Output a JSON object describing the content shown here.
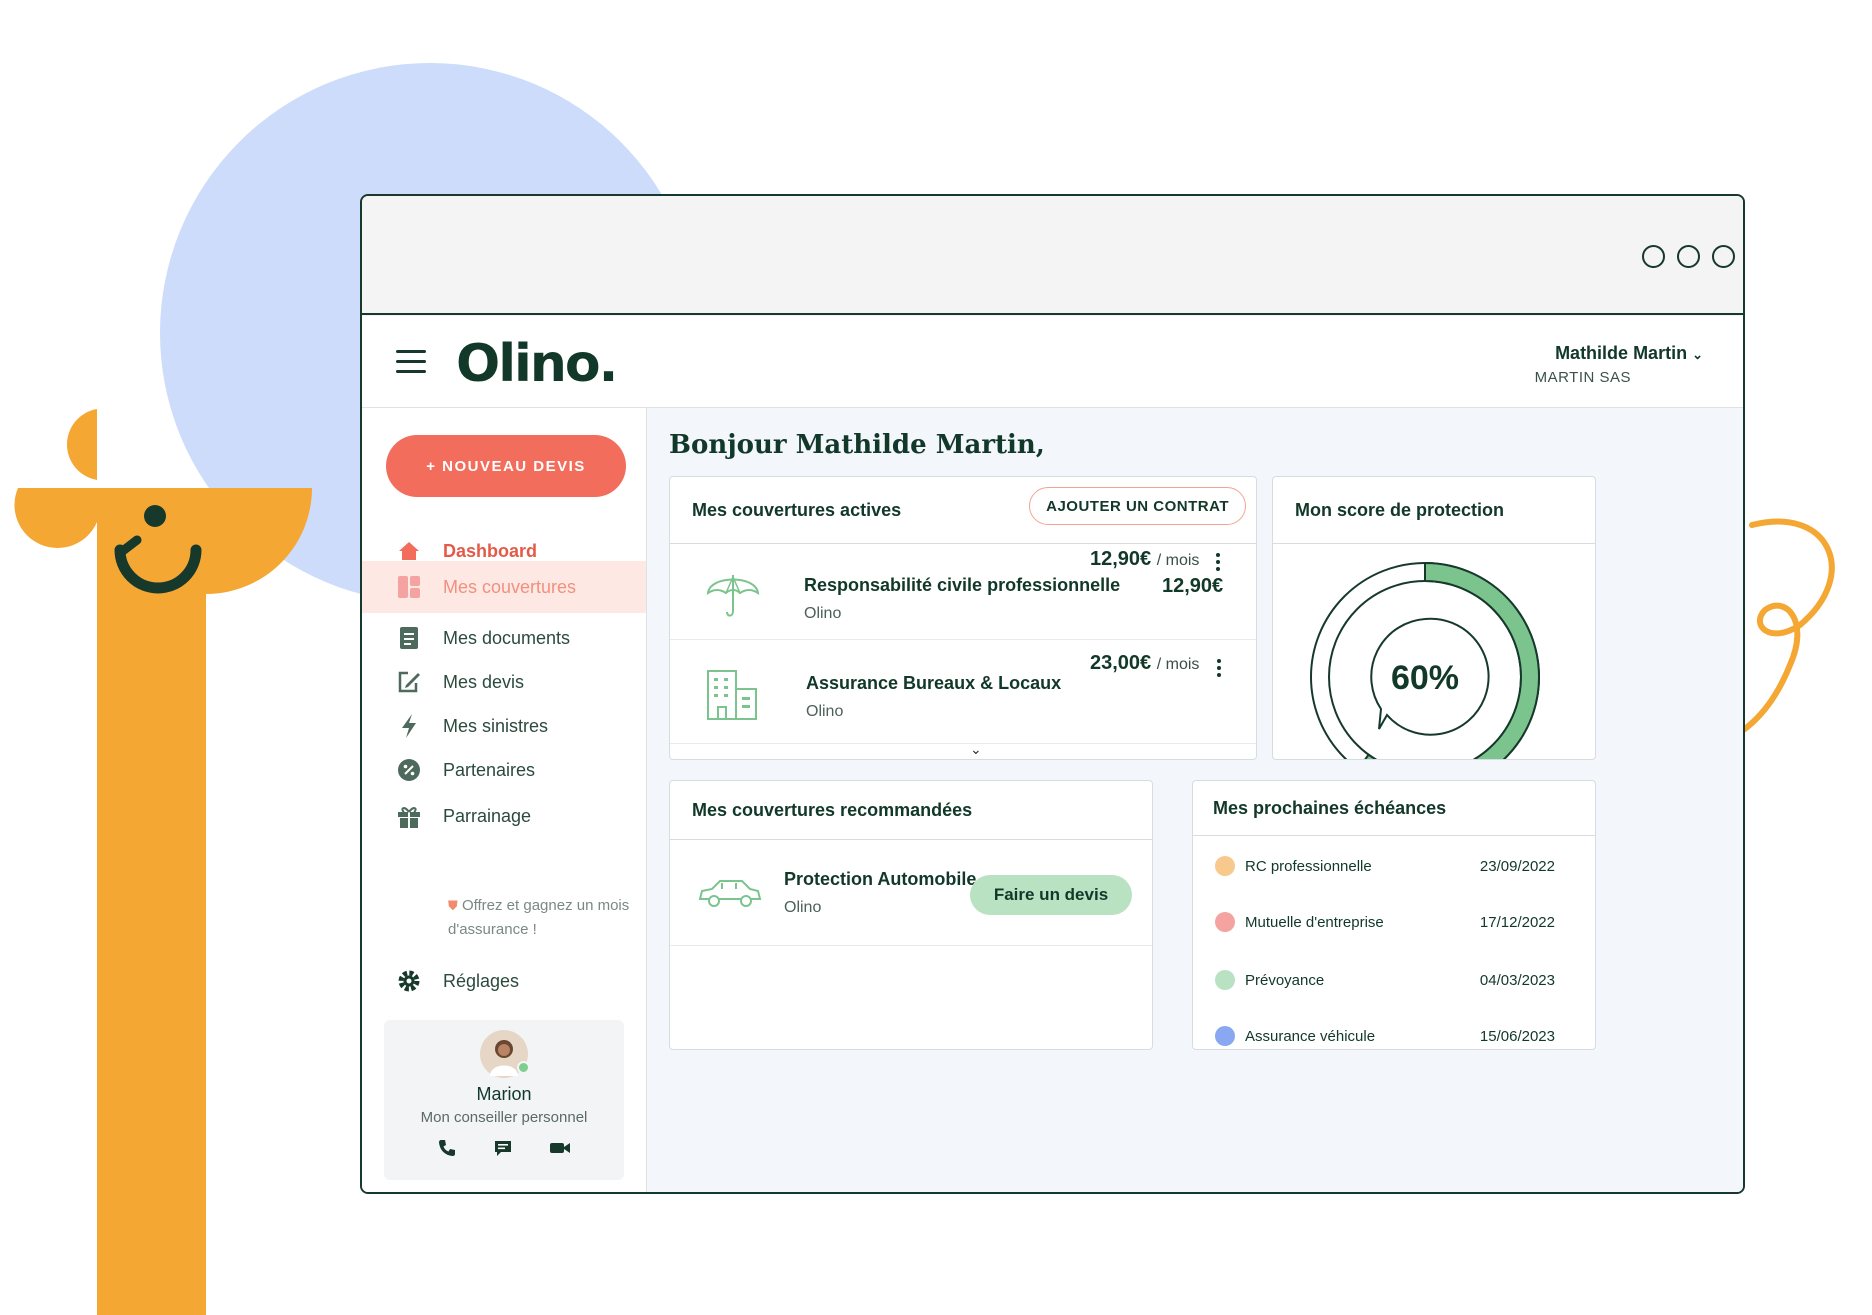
{
  "header": {
    "logo": "Olino.",
    "user_name": "Mathilde Martin",
    "user_company": "MARTIN SAS"
  },
  "sidebar": {
    "new_quote_label": "+ NOUVEAU DEVIS",
    "items": [
      {
        "label": "Dashboard",
        "icon": "home-icon"
      },
      {
        "label": "Mes couvertures",
        "icon": "grid-icon"
      },
      {
        "label": "Mes documents",
        "icon": "document-icon"
      },
      {
        "label": "Mes devis",
        "icon": "edit-icon"
      },
      {
        "label": "Mes sinistres",
        "icon": "lightning-icon"
      },
      {
        "label": "Partenaires",
        "icon": "percent-badge-icon"
      },
      {
        "label": "Parrainage",
        "icon": "gift-icon"
      },
      {
        "label": "Réglages",
        "icon": "gear-icon"
      }
    ],
    "sponsor_sub": "Offrez et gagnez un mois d'assurance !",
    "advisor": {
      "name": "Marion",
      "role": "Mon conseiller personnel"
    }
  },
  "main": {
    "greeting": "Bonjour Mathilde Martin,",
    "active": {
      "title": "Mes couvertures actives",
      "add_label": "AJOUTER UN CONTRAT",
      "rows": [
        {
          "title": "Responsabilité civile professionnelle",
          "provider": "Olino",
          "price": "12,90€",
          "period": "/ mois"
        },
        {
          "title": "Assurance Bureaux & Locaux",
          "provider": "Olino",
          "price": "23,00€",
          "period": "/ mois"
        }
      ]
    },
    "score": {
      "title": "Mon score de protection",
      "value_label": "60%",
      "value": 0.6
    },
    "recommended": {
      "title": "Mes couvertures recommandées",
      "rows": [
        {
          "title": "Protection Automobile",
          "provider": "Olino",
          "cta": "Faire un devis"
        }
      ]
    },
    "due": {
      "title": "Mes prochaines échéances",
      "items": [
        {
          "label": "RC professionnelle",
          "date": "23/09/2022",
          "color": "#f7c98c"
        },
        {
          "label": "Mutuelle d'entreprise",
          "date": "17/12/2022",
          "color": "#f4a3a0"
        },
        {
          "label": "Prévoyance",
          "date": "04/03/2023",
          "color": "#b9e2c3"
        },
        {
          "label": "Assurance véhicule",
          "date": "15/06/2023",
          "color": "#8aa8f2"
        }
      ]
    }
  },
  "colors": {
    "accent": "#f26d5b",
    "brand_dark": "#123829",
    "success": "#7cc48e",
    "mascot": "#f5a733",
    "decor_blue": "#cddcfa"
  }
}
